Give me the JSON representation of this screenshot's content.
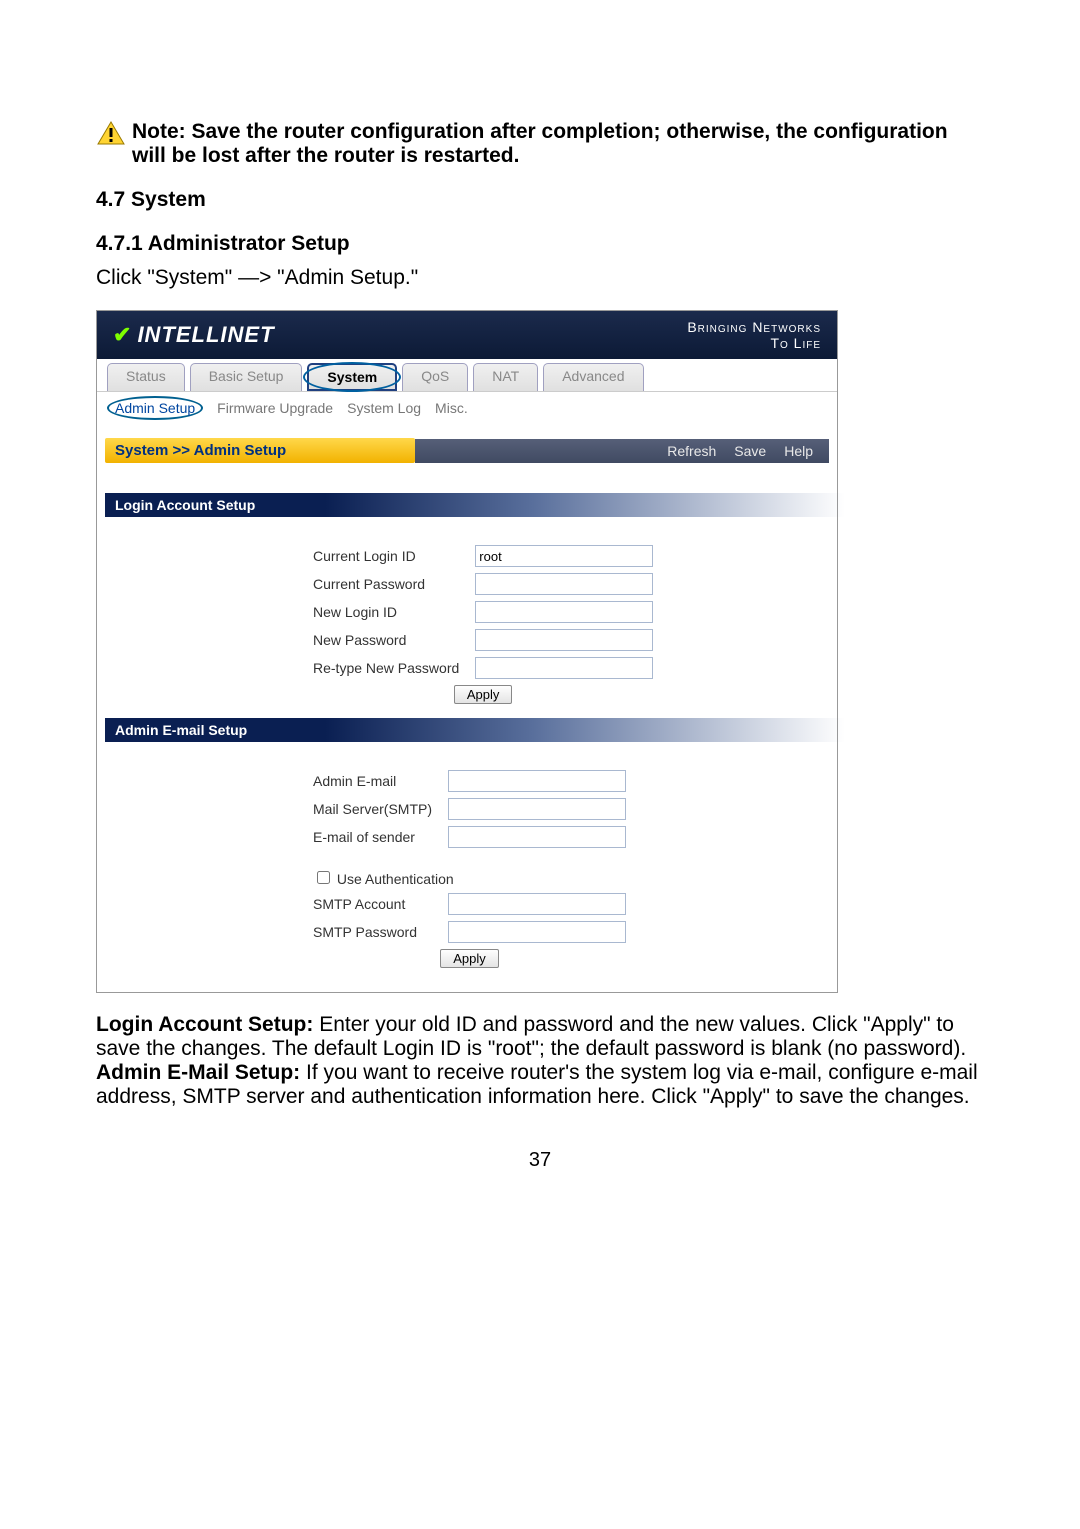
{
  "note": "Note: Save the router configuration after completion; otherwise, the configuration will be lost after the router is restarted.",
  "sectionHeading": "4.7 System",
  "subHeading": "4.7.1 Administrator Setup",
  "instruction": "Click \"System\" —> \"Admin Setup.\"",
  "brand": "INTELLINET",
  "sloganLine1": "Bringing Networks",
  "sloganLine2": "To Life",
  "mainTabs": [
    "Status",
    "Basic Setup",
    "System",
    "QoS",
    "NAT",
    "Advanced"
  ],
  "mainTabActive": "System",
  "subTabs": [
    "Admin Setup",
    "Firmware Upgrade",
    "System Log",
    "Misc."
  ],
  "subTabActive": "Admin Setup",
  "breadcrumb": "System >> Admin Setup",
  "actions": [
    "Refresh",
    "Save",
    "Help"
  ],
  "sections": {
    "login": {
      "title": "Login Account Setup",
      "fields": {
        "currentLoginIdLabel": "Current Login ID",
        "currentLoginIdValue": "root",
        "currentPasswordLabel": "Current Password",
        "newLoginIdLabel": "New Login ID",
        "newPasswordLabel": "New Password",
        "retypePasswordLabel": "Re-type New Password",
        "applyLabel": "Apply"
      }
    },
    "email": {
      "title": "Admin E-mail Setup",
      "fields": {
        "adminEmailLabel": "Admin E-mail",
        "mailServerLabel": "Mail Server(SMTP)",
        "emailSenderLabel": "E-mail of sender",
        "useAuthLabel": "Use Authentication",
        "smtpAccountLabel": "SMTP Account",
        "smtpPasswordLabel": "SMTP Password",
        "applyLabel": "Apply"
      }
    }
  },
  "explain": {
    "loginBold": "Login Account Setup:",
    "loginText": " Enter your old ID and password and the new values. Click \"Apply\" to save the changes. The default Login ID is \"root\"; the default password is blank (no password).",
    "emailBold": "Admin E-Mail Setup:",
    "emailText": " If you want to receive router's the system log via e-mail, configure e-mail address, SMTP server and authentication information here. Click \"Apply\" to save the changes."
  },
  "pageNumber": "37"
}
